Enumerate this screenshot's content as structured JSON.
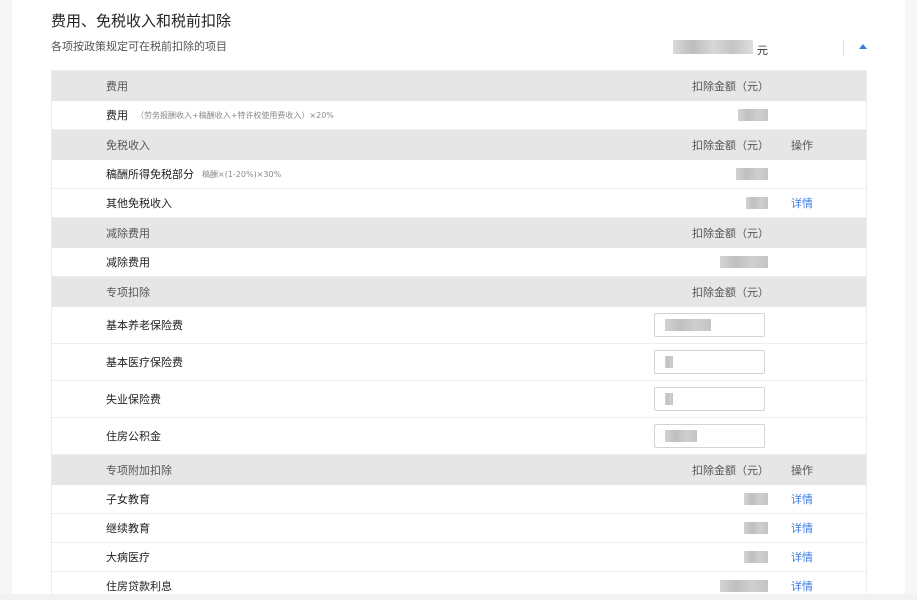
{
  "header": {
    "title": "费用、免税收入和税前扣除",
    "subtitle": "各项按政策规定可在税前扣除的项目",
    "unit": "元"
  },
  "sections": {
    "fees": {
      "label": "费用",
      "amount_header": "扣除金额（元）",
      "item_label": "费用",
      "item_note": "（劳务报酬收入+稿酬收入+特许权使用费收入）×20%"
    },
    "exempt": {
      "label": "免税收入",
      "amount_header": "扣除金额（元）",
      "op_header": "操作",
      "items": [
        {
          "label": "稿酬所得免税部分",
          "note": "稿酬×(1-20%)×30%"
        },
        {
          "label": "其他免税收入",
          "action": "详情"
        }
      ]
    },
    "reduction": {
      "label": "减除费用",
      "amount_header": "扣除金额（元）",
      "item_label": "减除费用"
    },
    "special": {
      "label": "专项扣除",
      "amount_header": "扣除金额（元）",
      "items": [
        {
          "label": "基本养老保险费"
        },
        {
          "label": "基本医疗保险费"
        },
        {
          "label": "失业保险费"
        },
        {
          "label": "住房公积金"
        }
      ]
    },
    "additional": {
      "label": "专项附加扣除",
      "amount_header": "扣除金额（元）",
      "op_header": "操作",
      "items": [
        {
          "label": "子女教育",
          "action": "详情"
        },
        {
          "label": "继续教育",
          "action": "详情"
        },
        {
          "label": "大病医疗",
          "action": "详情"
        },
        {
          "label": "住房贷款利息",
          "action": "详情"
        }
      ]
    }
  },
  "colors": {
    "accent": "#3d7be0",
    "section_bg": "#e6e6e6"
  },
  "icons": {
    "collapse": "caret-up-icon"
  }
}
